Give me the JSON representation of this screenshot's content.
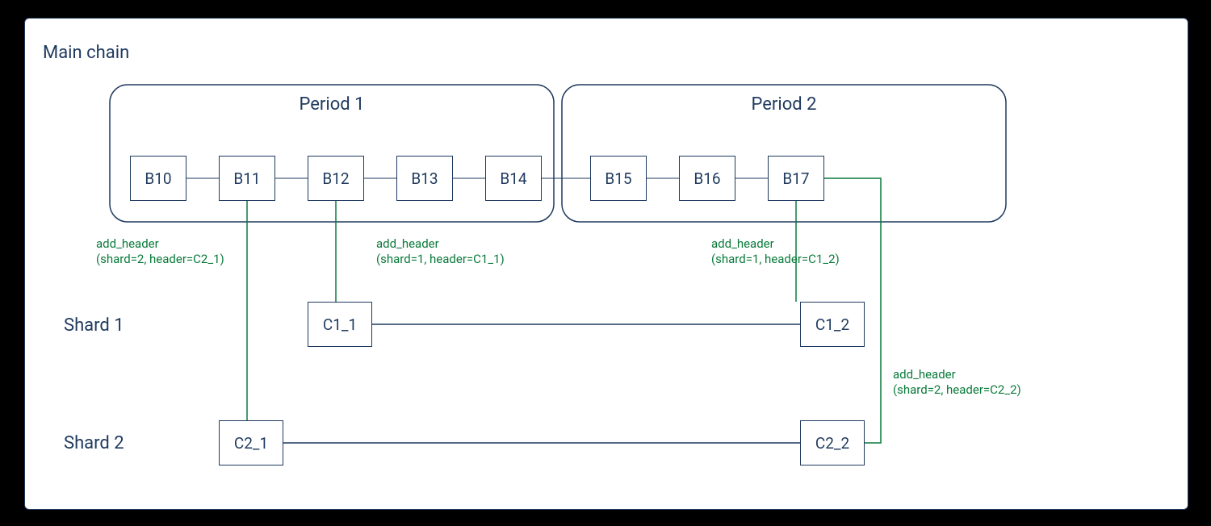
{
  "labels": {
    "main_chain": "Main chain",
    "shard1": "Shard 1",
    "shard2": "Shard 2"
  },
  "periods": {
    "p1": {
      "title": "Period 1"
    },
    "p2": {
      "title": "Period 2"
    }
  },
  "blocks": {
    "b10": "B10",
    "b11": "B11",
    "b12": "B12",
    "b13": "B13",
    "b14": "B14",
    "b15": "B15",
    "b16": "B16",
    "b17": "B17",
    "c1_1": "C1_1",
    "c1_2": "C1_2",
    "c2_1": "C2_1",
    "c2_2": "C2_2"
  },
  "edges": {
    "e1": {
      "line1": "add_header",
      "line2": "(shard=2, header=C2_1)"
    },
    "e2": {
      "line1": "add_header",
      "line2": "(shard=1, header=C1_1)"
    },
    "e3": {
      "line1": "add_header",
      "line2": "(shard=1, header=C1_2)"
    },
    "e4": {
      "line1": "add_header",
      "line2": "(shard=2, header=C2_2)"
    }
  },
  "colors": {
    "stroke": "#1f3a5f",
    "green": "#0a7a3b"
  }
}
